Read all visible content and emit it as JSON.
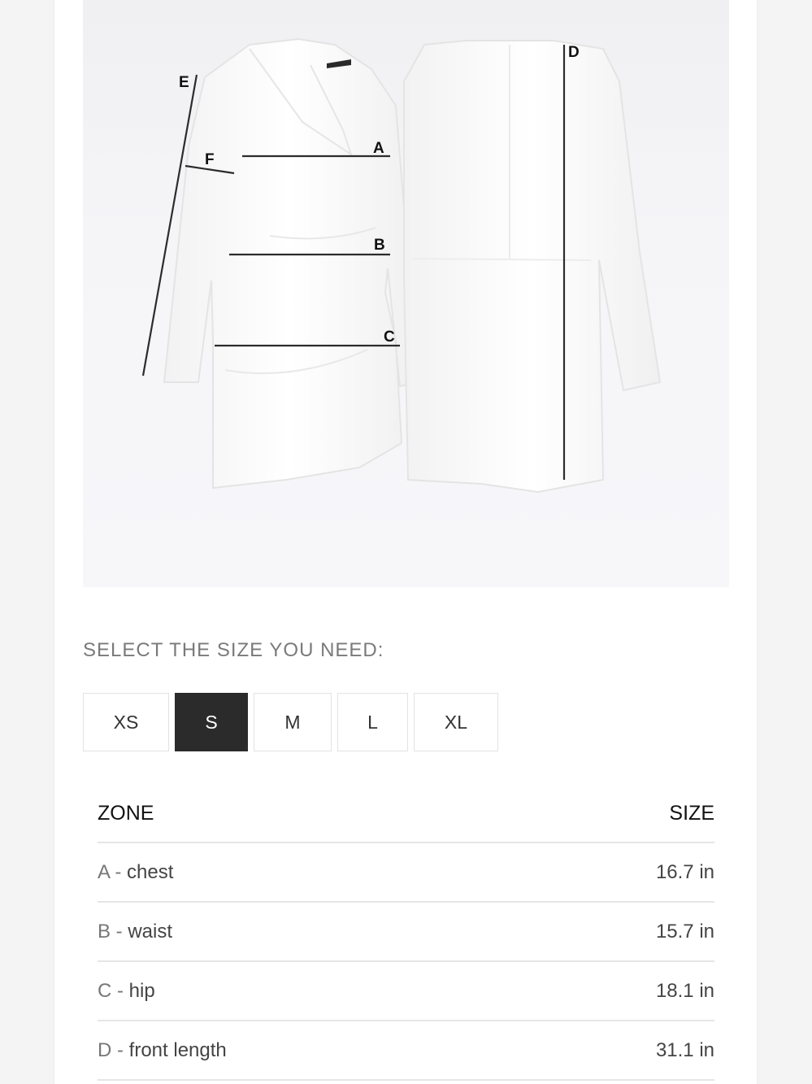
{
  "diagram": {
    "labels": {
      "a": "A",
      "b": "B",
      "c": "C",
      "d": "D",
      "e": "E",
      "f": "F"
    }
  },
  "size_selector": {
    "title": "SELECT THE SIZE YOU NEED:",
    "options": [
      "XS",
      "S",
      "M",
      "L",
      "XL"
    ],
    "selected": "S"
  },
  "table": {
    "headers": {
      "zone": "ZONE",
      "size": "SIZE"
    },
    "rows": [
      {
        "letter": "A",
        "sep": " - ",
        "name": "chest",
        "value": "16.7 in"
      },
      {
        "letter": "B",
        "sep": " - ",
        "name": "waist",
        "value": "15.7 in"
      },
      {
        "letter": "C",
        "sep": " - ",
        "name": "hip",
        "value": "18.1 in"
      },
      {
        "letter": "D",
        "sep": " - ",
        "name": "front length",
        "value": "31.1 in"
      }
    ]
  },
  "colors": {
    "selected_bg": "#2b2b2b",
    "selected_text": "#ffffff",
    "divider": "#e6e6e6"
  }
}
